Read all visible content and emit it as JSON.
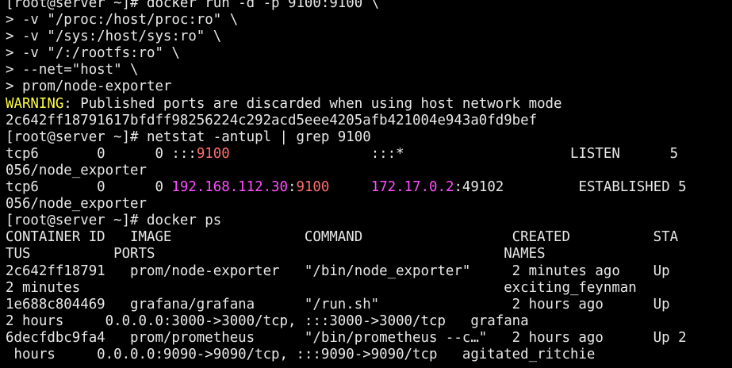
{
  "window": {
    "background": "#000000",
    "foreground": "#e8e8e8"
  },
  "colors": {
    "warning": "#ffff40",
    "port": "#ff6e6e",
    "ip": "#ff4dff"
  },
  "lines": [
    {
      "segments": [
        {
          "text": "[root@server ~]# docker run -d -p 9100:9100 \\",
          "style": "normal"
        }
      ]
    },
    {
      "segments": [
        {
          "text": "> -v \"/proc:/host/proc:ro\" \\",
          "style": "normal"
        }
      ]
    },
    {
      "segments": [
        {
          "text": "> -v \"/sys:/host/sys:ro\" \\",
          "style": "normal"
        }
      ]
    },
    {
      "segments": [
        {
          "text": "> -v \"/:/rootfs:ro\" \\",
          "style": "normal"
        }
      ]
    },
    {
      "segments": [
        {
          "text": "> --net=\"host\" \\",
          "style": "normal"
        }
      ]
    },
    {
      "segments": [
        {
          "text": "> prom/node-exporter",
          "style": "normal"
        }
      ]
    },
    {
      "segments": [
        {
          "text": "WARNING",
          "style": "warn"
        },
        {
          "text": ": Published ports are discarded when using host network mode",
          "style": "normal"
        }
      ]
    },
    {
      "segments": [
        {
          "text": "2c642ff18791617bfdff98256224c292acd5eee4205afb421004e943a0fd9bef",
          "style": "normal"
        }
      ]
    },
    {
      "segments": [
        {
          "text": "[root@server ~]# netstat -antupl | grep 9100",
          "style": "normal"
        }
      ]
    },
    {
      "segments": [
        {
          "text": "tcp6       0      0 :::",
          "style": "normal"
        },
        {
          "text": "9100",
          "style": "port"
        },
        {
          "text": "                 :::*                    LISTEN      5",
          "style": "normal"
        }
      ]
    },
    {
      "segments": [
        {
          "text": "056/node_exporter",
          "style": "normal"
        }
      ]
    },
    {
      "segments": [
        {
          "text": "tcp6       0      0 ",
          "style": "normal"
        },
        {
          "text": "192.168.112.30",
          "style": "ip"
        },
        {
          "text": ":",
          "style": "normal"
        },
        {
          "text": "9100",
          "style": "port"
        },
        {
          "text": "     ",
          "style": "normal"
        },
        {
          "text": "172.17.0.2",
          "style": "ip"
        },
        {
          "text": ":49102         ESTABLISHED 5",
          "style": "normal"
        }
      ]
    },
    {
      "segments": [
        {
          "text": "056/node_exporter",
          "style": "normal"
        }
      ]
    },
    {
      "segments": [
        {
          "text": "[root@server ~]# docker ps",
          "style": "normal"
        }
      ]
    },
    {
      "segments": [
        {
          "text": "CONTAINER ID   IMAGE                COMMAND                  CREATED          STA",
          "style": "normal"
        }
      ]
    },
    {
      "segments": [
        {
          "text": "TUS          PORTS                                          NAMES",
          "style": "normal"
        }
      ]
    },
    {
      "segments": [
        {
          "text": "2c642ff18791   prom/node-exporter   \"/bin/node_exporter\"     2 minutes ago    Up",
          "style": "normal"
        }
      ]
    },
    {
      "segments": [
        {
          "text": "2 minutes                                                   exciting_feynman",
          "style": "normal"
        }
      ]
    },
    {
      "segments": [
        {
          "text": "1e688c804469   grafana/grafana      \"/run.sh\"                2 hours ago      Up",
          "style": "normal"
        }
      ]
    },
    {
      "segments": [
        {
          "text": "2 hours     0.0.0.0:3000->3000/tcp, :::3000->3000/tcp   grafana",
          "style": "normal"
        }
      ]
    },
    {
      "segments": [
        {
          "text": "6decfdbc9fa4   prom/prometheus      \"/bin/prometheus --c…\"   2 hours ago      Up 2",
          "style": "normal"
        }
      ]
    },
    {
      "segments": [
        {
          "text": " hours     0.0.0.0:9090->9090/tcp, :::9090->9090/tcp   agitated_ritchie",
          "style": "normal"
        }
      ]
    }
  ]
}
